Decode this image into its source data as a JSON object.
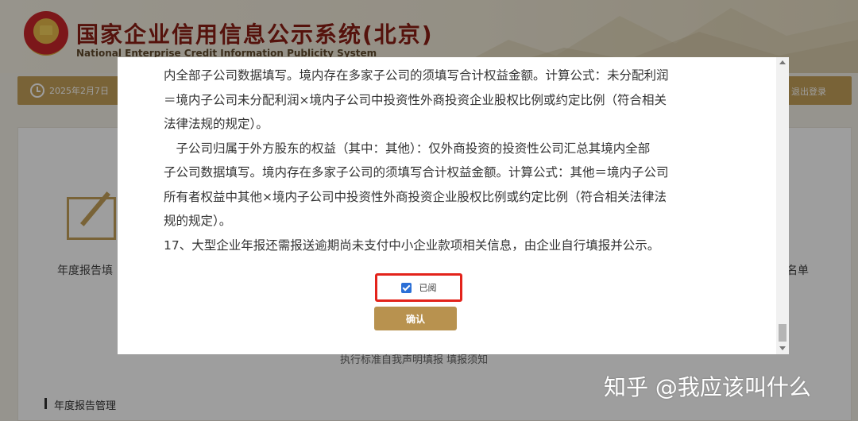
{
  "header": {
    "title": "国家企业信用信息公示系统(北京)",
    "subtitle": "National Enterprise Credit Information Publicity System"
  },
  "nav": {
    "date": "2025年2月7日",
    "logout_label": "退出登录"
  },
  "background": {
    "card_label_left": "年度报告填",
    "card_label_right": "名单",
    "bottom_links": "执行标准自我声明填报    填报须知",
    "section_title": "年度报告管理"
  },
  "modal": {
    "paragraphs": [
      "内全部子公司数据填写。境内存在多家子公司的须填写合计权益金额。计算公式：未分配利润",
      "＝境内子公司未分配利润×境内子公司中投资性外商投资企业股权比例或约定比例（符合相关",
      "法律法规的规定）。",
      "　子公司归属于外方股东的权益（其中：其他）：仅外商投资的投资性公司汇总其境内全部",
      "子公司数据填写。境内存在多家子公司的须填写合计权益金额。计算公式：其他＝境内子公司",
      "所有者权益中其他×境内子公司中投资性外商投资企业股权比例或约定比例（符合相关法律法",
      "规的规定）。",
      "17、大型企业年报还需报送逾期尚未支付中小企业款项相关信息，由企业自行填报并公示。"
    ],
    "read_checkbox": {
      "label": "已阅",
      "checked": true
    },
    "confirm_label": "确认"
  },
  "watermark": "知乎 @我应该叫什么",
  "colors": {
    "gold": "#c4a05a",
    "button": "#b8924f",
    "highlight_border": "#e3231b",
    "title_red": "#8a1d14"
  }
}
